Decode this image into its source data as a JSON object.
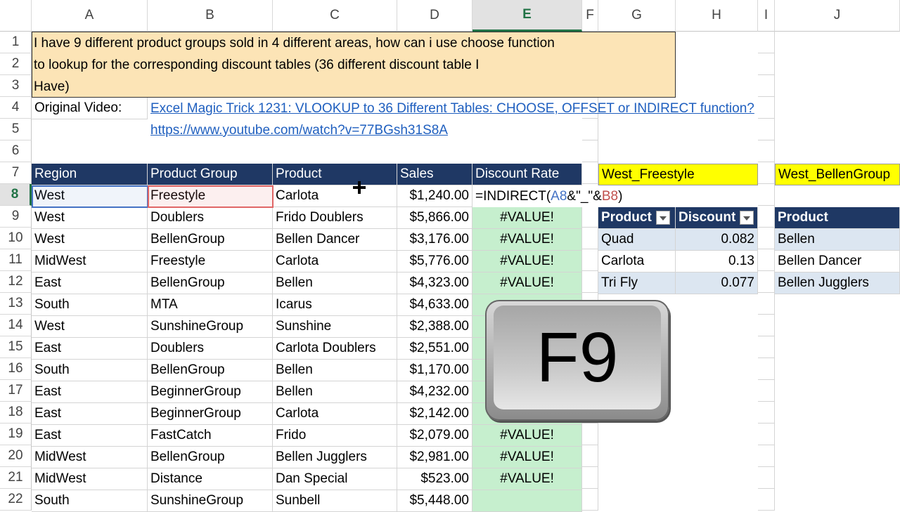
{
  "columns": [
    "A",
    "B",
    "C",
    "D",
    "E",
    "F",
    "G",
    "H",
    "I",
    "J"
  ],
  "rows": [
    "1",
    "2",
    "3",
    "4",
    "5",
    "6",
    "7",
    "8",
    "9",
    "10",
    "11",
    "12",
    "13",
    "14",
    "15",
    "16",
    "17",
    "18",
    "19",
    "20",
    "21",
    "22"
  ],
  "note": {
    "line1": "I have 9 different product groups sold in 4 different areas, how can i use choose function",
    "line2": "to lookup for the corresponding discount tables (36 different discount table I",
    "line3": "Have)"
  },
  "original_video_label": "Original Video:",
  "link1": "Excel Magic Trick 1231: VLOOKUP to 36 Different Tables: CHOOSE, OFFSET or INDIRECT function?",
  "link2": "https://www.youtube.com/watch?v=77BGsh31S8A",
  "table_headers": [
    "Region",
    "Product Group",
    "Product",
    "Sales",
    "Discount Rate"
  ],
  "formula": {
    "prefix": "=INDIRECT(",
    "ref_a": "A8",
    "mid": "&\"_\"&",
    "ref_b": "B8",
    "suffix": ")"
  },
  "data_rows": [
    {
      "region": "West",
      "group": "Freestyle",
      "product": "Carlota",
      "sales": "$1,240.00",
      "rate": ""
    },
    {
      "region": "West",
      "group": "Doublers",
      "product": "Frido Doublers",
      "sales": "$5,866.00",
      "rate": "#VALUE!"
    },
    {
      "region": "West",
      "group": "BellenGroup",
      "product": "Bellen Dancer",
      "sales": "$3,176.00",
      "rate": "#VALUE!"
    },
    {
      "region": "MidWest",
      "group": "Freestyle",
      "product": "Carlota",
      "sales": "$5,776.00",
      "rate": "#VALUE!"
    },
    {
      "region": "East",
      "group": "BellenGroup",
      "product": "Bellen",
      "sales": "$4,323.00",
      "rate": "#VALUE!"
    },
    {
      "region": "South",
      "group": "MTA",
      "product": "Icarus",
      "sales": "$4,633.00",
      "rate": ""
    },
    {
      "region": "West",
      "group": "SunshineGroup",
      "product": "Sunshine",
      "sales": "$2,388.00",
      "rate": ""
    },
    {
      "region": "East",
      "group": "Doublers",
      "product": "Carlota Doublers",
      "sales": "$2,551.00",
      "rate": ""
    },
    {
      "region": "South",
      "group": "BellenGroup",
      "product": "Bellen",
      "sales": "$1,170.00",
      "rate": ""
    },
    {
      "region": "East",
      "group": "BeginnerGroup",
      "product": "Bellen",
      "sales": "$4,232.00",
      "rate": ""
    },
    {
      "region": "East",
      "group": "BeginnerGroup",
      "product": "Carlota",
      "sales": "$2,142.00",
      "rate": ""
    },
    {
      "region": "East",
      "group": "FastCatch",
      "product": "Frido",
      "sales": "$2,079.00",
      "rate": "#VALUE!"
    },
    {
      "region": "MidWest",
      "group": "BellenGroup",
      "product": "Bellen Jugglers",
      "sales": "$2,981.00",
      "rate": "#VALUE!"
    },
    {
      "region": "MidWest",
      "group": "Distance",
      "product": "Dan Special",
      "sales": "$523.00",
      "rate": "#VALUE!"
    },
    {
      "region": "South",
      "group": "SunshineGroup",
      "product": "Sunbell",
      "sales": "$5,448.00",
      "rate": ""
    }
  ],
  "west_freestyle": {
    "title": "West_Freestyle",
    "headers": [
      "Product",
      "Discount"
    ],
    "rows": [
      {
        "product": "Quad",
        "discount": "0.082"
      },
      {
        "product": "Carlota",
        "discount": "0.13"
      },
      {
        "product": "Tri Fly",
        "discount": "0.077"
      }
    ]
  },
  "west_bellen": {
    "title": "West_BellenGroup",
    "header": "Product",
    "rows": [
      "Bellen",
      "Bellen Dancer",
      "Bellen Jugglers"
    ]
  },
  "key_label": "F9"
}
